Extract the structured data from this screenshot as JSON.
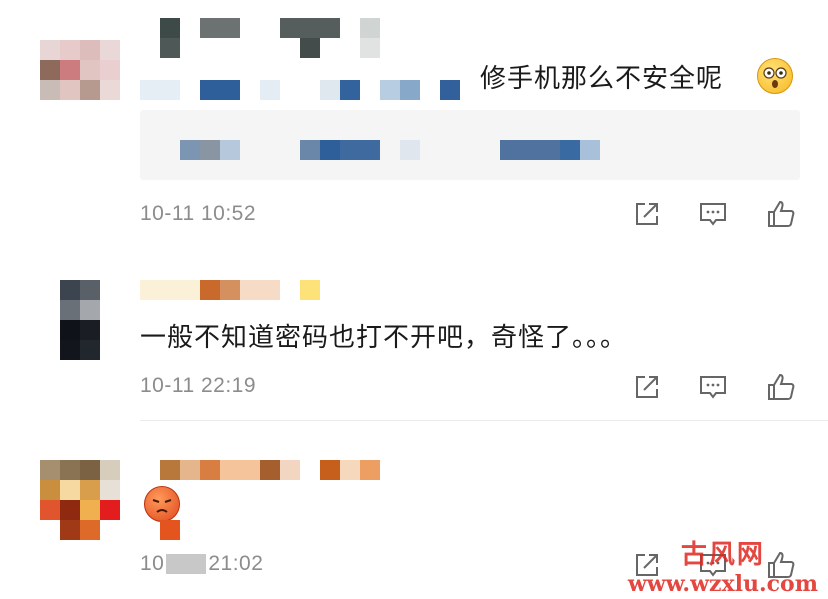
{
  "comments": [
    {
      "text": "修手机那么不安全呢",
      "emoji": "shocked-emoji",
      "time": "10-11 10:52"
    },
    {
      "text": "一般不知道密码也打不开吧，奇怪了。。。",
      "time": "10-11 22:19"
    },
    {
      "emoji": "pouting-emoji",
      "time_prefix": "10",
      "time_suffix": "21:02"
    }
  ],
  "actions": {
    "share_icon": "share-icon",
    "comment_icon": "comment-icon",
    "like_icon": "thumbs-up-icon"
  },
  "watermark": {
    "title": "古风网",
    "url": "www.wzxlu.com"
  },
  "colors": {
    "meta_text": "#8c8c8c",
    "watermark": "#e0261f"
  }
}
